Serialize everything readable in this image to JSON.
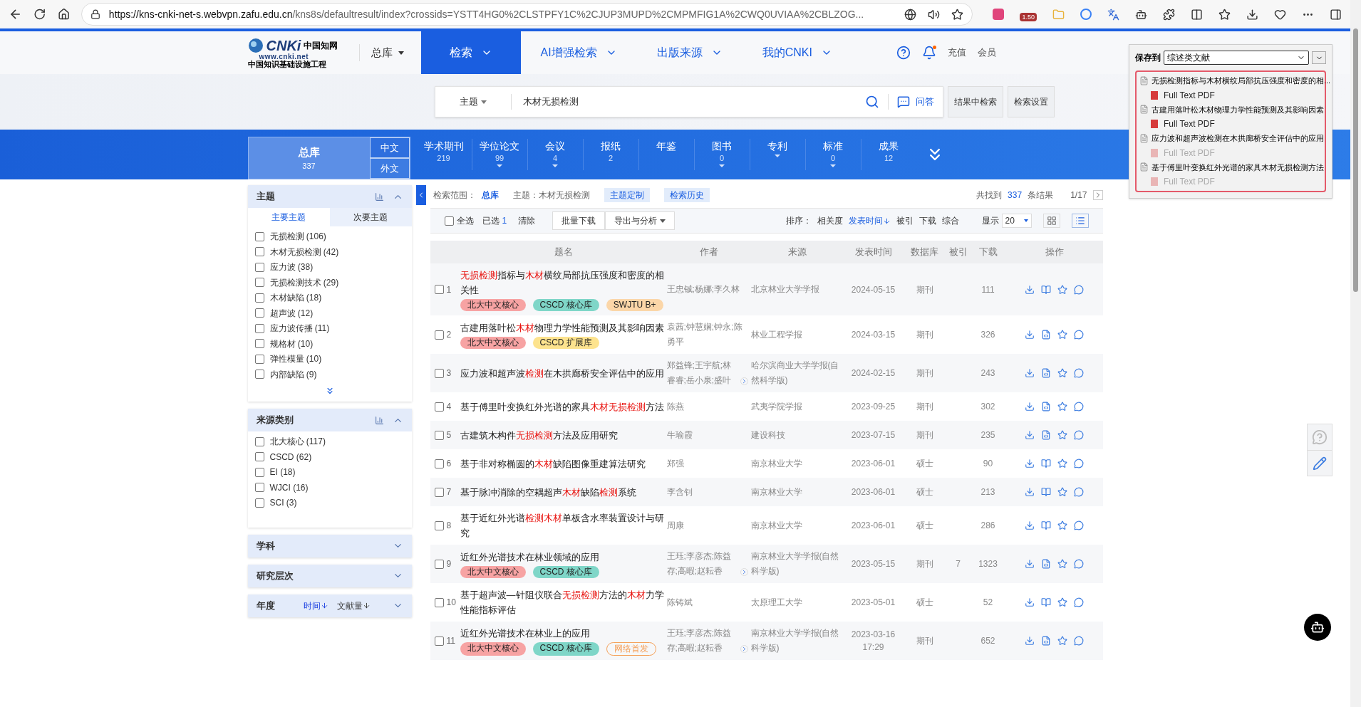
{
  "browser": {
    "url_host": "https://kns-cnki-net-s.webvpn.zafu.edu.cn",
    "url_path": "/kns8s/defaultresult/index?crossids=YSTT4HG0%2CLSTPFY1C%2CJUP3MUPD%2CMPMFIG1A%2CWQ0UVIAA%2CBLZOG...",
    "badge": "1.50"
  },
  "logo": {
    "mark": "CNKi",
    "name": "中国知网",
    "site": "www.cnki.net",
    "slogan": "中国知识基础设施工程"
  },
  "nav": {
    "scope": "总库",
    "items": [
      {
        "label": "检索",
        "selected": true
      },
      {
        "label": "AI增强检索",
        "selected": false
      },
      {
        "label": "出版来源",
        "selected": false
      },
      {
        "label": "我的CNKI",
        "selected": false
      }
    ],
    "links": [
      "充值",
      "会员"
    ]
  },
  "search": {
    "field": "主题",
    "value": "木材无损检测",
    "qa": "问答",
    "buttons": [
      "结果中检索",
      "检索设置"
    ]
  },
  "databases": {
    "total": {
      "label": "总库",
      "count": "337",
      "languages": [
        "中文",
        "外文"
      ]
    },
    "items": [
      {
        "label": "学术期刊",
        "count": "219",
        "has_menu": false
      },
      {
        "label": "学位论文",
        "count": "99",
        "has_menu": true
      },
      {
        "label": "会议",
        "count": "4",
        "has_menu": true
      },
      {
        "label": "报纸",
        "count": "2",
        "has_menu": false
      },
      {
        "label": "年鉴",
        "has_menu": false
      },
      {
        "label": "图书",
        "count": "0",
        "has_menu": true
      },
      {
        "label": "专利",
        "has_menu": true
      },
      {
        "label": "标准",
        "count": "0",
        "has_menu": true
      },
      {
        "label": "成果",
        "count": "12",
        "has_menu": false
      }
    ]
  },
  "sidebar": [
    {
      "title": "主题",
      "expanded": true,
      "chart": true,
      "subtabs": [
        {
          "label": "主要主题",
          "selected": true
        },
        {
          "label": "次要主题",
          "selected": false
        }
      ],
      "more": true,
      "items": [
        {
          "label": "无损检测 (106)",
          "checked": false
        },
        {
          "label": "木材无损检测 (42)",
          "checked": false
        },
        {
          "label": "应力波 (38)",
          "checked": false
        },
        {
          "label": "无损检测技术 (29)",
          "checked": false
        },
        {
          "label": "木材缺陷 (18)",
          "checked": false
        },
        {
          "label": "超声波 (12)",
          "checked": false
        },
        {
          "label": "应力波传播 (11)",
          "checked": false
        },
        {
          "label": "规格材 (10)",
          "checked": false
        },
        {
          "label": "弹性模量 (10)",
          "checked": false
        },
        {
          "label": "内部缺陷 (9)",
          "checked": false
        }
      ]
    },
    {
      "title": "来源类别",
      "expanded": true,
      "chart": true,
      "more": false,
      "items": [
        {
          "label": "北大核心 (117)",
          "checked": false
        },
        {
          "label": "CSCD (62)",
          "checked": false
        },
        {
          "label": "EI (18)",
          "checked": false
        },
        {
          "label": "WJCI (16)",
          "checked": false
        },
        {
          "label": "SCI (3)",
          "checked": false
        }
      ]
    },
    {
      "title": "学科",
      "expanded": false,
      "chart": false
    },
    {
      "title": "研究层次",
      "expanded": false,
      "chart": false
    },
    {
      "title": "年度",
      "expanded": false,
      "chart": false,
      "sorts": [
        {
          "label": "时间",
          "selected": true
        },
        {
          "label": "文献量",
          "selected": false
        }
      ]
    }
  ],
  "results": {
    "scope_label": "检索范围：",
    "scope": "总库",
    "query": "主题：木材无损检测",
    "buttons": [
      "主题定制",
      "检索历史"
    ],
    "found_prefix": "共找到",
    "found": "337",
    "found_suffix": "条结果",
    "page": "1/17"
  },
  "toolbar": {
    "select_all": "全选",
    "select_all_checked": false,
    "selected_label": "已选",
    "selected_count": "1",
    "clear": "清除",
    "buttons": [
      {
        "label": "批量下载",
        "menu": false
      },
      {
        "label": "导出与分析",
        "menu": true
      }
    ],
    "sort_label": "排序：",
    "sorts": [
      {
        "label": "相关度",
        "selected": false
      },
      {
        "label": "发表时间",
        "selected": true
      },
      {
        "label": "被引",
        "selected": false
      },
      {
        "label": "下载",
        "selected": false
      },
      {
        "label": "综合",
        "selected": false
      }
    ],
    "show_label": "显示",
    "page_size": "20",
    "views": [
      {
        "kind": "grid",
        "selected": false
      },
      {
        "kind": "list",
        "selected": true
      }
    ]
  },
  "columns": [
    "题名",
    "作者",
    "来源",
    "发表时间",
    "数据库",
    "被引",
    "下载",
    "操作"
  ],
  "rows": [
    {
      "number": "1",
      "checked": false,
      "title": [
        {
          "text": "无损检测",
          "hl": true
        },
        {
          "text": "指标与",
          "hl": false
        },
        {
          "text": "木材",
          "hl": true
        },
        {
          "text": "横纹局部抗压强度和密度的相关性",
          "hl": false
        }
      ],
      "tags": [
        {
          "label": "北大中文核心",
          "color": "#f7a3a3",
          "outline": false
        },
        {
          "label": "CSCD 核心库",
          "color": "#7fd6c8",
          "outline": false
        },
        {
          "label": "SWJTU B+",
          "color": "#fbd6a8",
          "outline": false
        }
      ],
      "authors": "王忠铖;杨娜;李久林",
      "more_authors": false,
      "source": "北京林业大学学报",
      "date": "2024-05-15",
      "database": "期刊",
      "cited": "",
      "downloads": "111",
      "kind": "book"
    },
    {
      "number": "2",
      "checked": false,
      "title": [
        {
          "text": "古建用落叶松",
          "hl": false
        },
        {
          "text": "木材",
          "hl": true
        },
        {
          "text": "物理力学性能预测及其影响因素",
          "hl": false
        }
      ],
      "tags": [
        {
          "label": "北大中文核心",
          "color": "#f7a3a3",
          "outline": false
        },
        {
          "label": "CSCD 扩展库",
          "color": "#fde38e",
          "outline": false
        }
      ],
      "authors": "袁茜;钟慧娴;钟永;陈勇平",
      "more_authors": false,
      "source": "林业工程学报",
      "date": "2024-03-15",
      "database": "期刊",
      "cited": "",
      "downloads": "326",
      "kind": "html"
    },
    {
      "number": "3",
      "checked": false,
      "title": [
        {
          "text": "应力波和超声波",
          "hl": false
        },
        {
          "text": "检测",
          "hl": true
        },
        {
          "text": "在木拱廊桥安全评估中的应用",
          "hl": false
        }
      ],
      "tags": [],
      "authors": "郑益锋;王宇航;林睿睿;岳小泉;盛叶",
      "more_authors": true,
      "source": "哈尔滨商业大学学报(自然科学版)",
      "date": "2024-02-15",
      "database": "期刊",
      "cited": "",
      "downloads": "243",
      "kind": "html"
    },
    {
      "number": "4",
      "checked": false,
      "title": [
        {
          "text": "基于傅里叶变换红外光谱的家具",
          "hl": false
        },
        {
          "text": "木材无损检测",
          "hl": true
        },
        {
          "text": "方法",
          "hl": false
        }
      ],
      "tags": [],
      "authors": "陈燕",
      "more_authors": false,
      "source": "武夷学院学报",
      "date": "2023-09-25",
      "database": "期刊",
      "cited": "",
      "downloads": "302",
      "kind": "html"
    },
    {
      "number": "5",
      "checked": false,
      "title": [
        {
          "text": "古建筑木构件",
          "hl": false
        },
        {
          "text": "无损检测",
          "hl": true
        },
        {
          "text": "方法及应用研究",
          "hl": false
        }
      ],
      "tags": [],
      "authors": "牛瑜霞",
      "more_authors": false,
      "source": "建设科技",
      "date": "2023-07-15",
      "database": "期刊",
      "cited": "",
      "downloads": "235",
      "kind": "html"
    },
    {
      "number": "6",
      "checked": false,
      "title": [
        {
          "text": "基于非对称椭圆的",
          "hl": false
        },
        {
          "text": "木材",
          "hl": true
        },
        {
          "text": "缺陷图像重建算法研究",
          "hl": false
        }
      ],
      "tags": [],
      "authors": "郑强",
      "more_authors": false,
      "source": "南京林业大学",
      "date": "2023-06-01",
      "database": "硕士",
      "cited": "",
      "downloads": "90",
      "kind": "book"
    },
    {
      "number": "7",
      "checked": false,
      "title": [
        {
          "text": "基于脉冲消除的空耦超声",
          "hl": false
        },
        {
          "text": "木材",
          "hl": true
        },
        {
          "text": "缺陷",
          "hl": false
        },
        {
          "text": "检测",
          "hl": true
        },
        {
          "text": "系统",
          "hl": false
        }
      ],
      "tags": [],
      "authors": "李含钊",
      "more_authors": false,
      "source": "南京林业大学",
      "date": "2023-06-01",
      "database": "硕士",
      "cited": "",
      "downloads": "213",
      "kind": "book"
    },
    {
      "number": "8",
      "checked": false,
      "title": [
        {
          "text": "基于近红外光谱",
          "hl": false
        },
        {
          "text": "检测木材",
          "hl": true
        },
        {
          "text": "单板含水率装置设计与研究",
          "hl": false
        }
      ],
      "tags": [],
      "authors": "周康",
      "more_authors": false,
      "source": "南京林业大学",
      "date": "2023-06-01",
      "database": "硕士",
      "cited": "",
      "downloads": "286",
      "kind": "book"
    },
    {
      "number": "9",
      "checked": false,
      "title": [
        {
          "text": "近红外光谱技术在林业领域的应用",
          "hl": false
        }
      ],
      "tags": [
        {
          "label": "北大中文核心",
          "color": "#f7a3a3",
          "outline": false
        },
        {
          "label": "CSCD 核心库",
          "color": "#7fd6c8",
          "outline": false
        }
      ],
      "authors": "王珏;李彦杰;陈益存;高暇;赵耘香",
      "more_authors": true,
      "source": "南京林业大学学报(自然科学版)",
      "date": "2023-05-15",
      "database": "期刊",
      "cited": "7",
      "downloads": "1323",
      "kind": "html"
    },
    {
      "number": "10",
      "checked": false,
      "title": [
        {
          "text": "基于超声波—针阻仪联合",
          "hl": false
        },
        {
          "text": "无损检测",
          "hl": true
        },
        {
          "text": "方法的",
          "hl": false
        },
        {
          "text": "木材",
          "hl": true
        },
        {
          "text": "力学性能指标评估",
          "hl": false
        }
      ],
      "tags": [],
      "authors": "陈铸斌",
      "more_authors": false,
      "source": "太原理工大学",
      "date": "2023-05-01",
      "database": "硕士",
      "cited": "",
      "downloads": "52",
      "kind": "book"
    },
    {
      "number": "11",
      "checked": false,
      "title": [
        {
          "text": "近红外光谱技术在林业上的应用",
          "hl": false
        }
      ],
      "tags": [
        {
          "label": "北大中文核心",
          "color": "#f7a3a3",
          "outline": false
        },
        {
          "label": "CSCD 核心库",
          "color": "#7fd6c8",
          "outline": false
        },
        {
          "label": "网络首发",
          "color": "#f5a15a",
          "outline": true
        }
      ],
      "authors": "王珏;李彦杰;陈益存;高暇;赵耘香",
      "more_authors": true,
      "source": "南京林业大学学报(自然科学版)",
      "date": "2023-03-16 17:29",
      "database": "期刊",
      "cited": "",
      "downloads": "652",
      "kind": "html"
    }
  ],
  "popup": {
    "label": "保存到",
    "folder": "综述类文献",
    "items": [
      {
        "title": "无损检测指标与木材横纹局部抗压强度和密度的相...",
        "file": "Full Text PDF",
        "disabled": false
      },
      {
        "title": "古建用落叶松木材物理力学性能预测及其影响因素",
        "file": "Full Text PDF",
        "disabled": false
      },
      {
        "title": "应力波和超声波检测在木拱廊桥安全评估中的应用",
        "file": "Full Text PDF",
        "disabled": true
      },
      {
        "title": "基于傅里叶变换红外光谱的家具木材无损检测方法",
        "file": "Full Text PDF",
        "disabled": true
      }
    ]
  }
}
